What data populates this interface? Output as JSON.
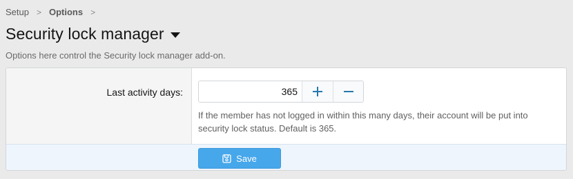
{
  "breadcrumb": {
    "items": [
      {
        "label": "Setup"
      },
      {
        "label": "Options"
      }
    ],
    "separator": ">"
  },
  "page": {
    "title": "Security lock manager",
    "title_menu_icon": "caret-down-icon",
    "description": "Options here control the Security lock manager add-on."
  },
  "field": {
    "label": "Last activity days:",
    "value": "365",
    "increment_icon": "plus-icon",
    "decrement_icon": "minus-icon",
    "hint": "If the member has not logged in within this many days, their account will be put into security lock status. Default is 365."
  },
  "footer": {
    "save_label": "Save",
    "save_icon": "floppy-disk-icon"
  },
  "colors": {
    "accent": "#47a7eb",
    "icon_blue": "#2577b1",
    "footer_bg": "#eef5fc"
  }
}
